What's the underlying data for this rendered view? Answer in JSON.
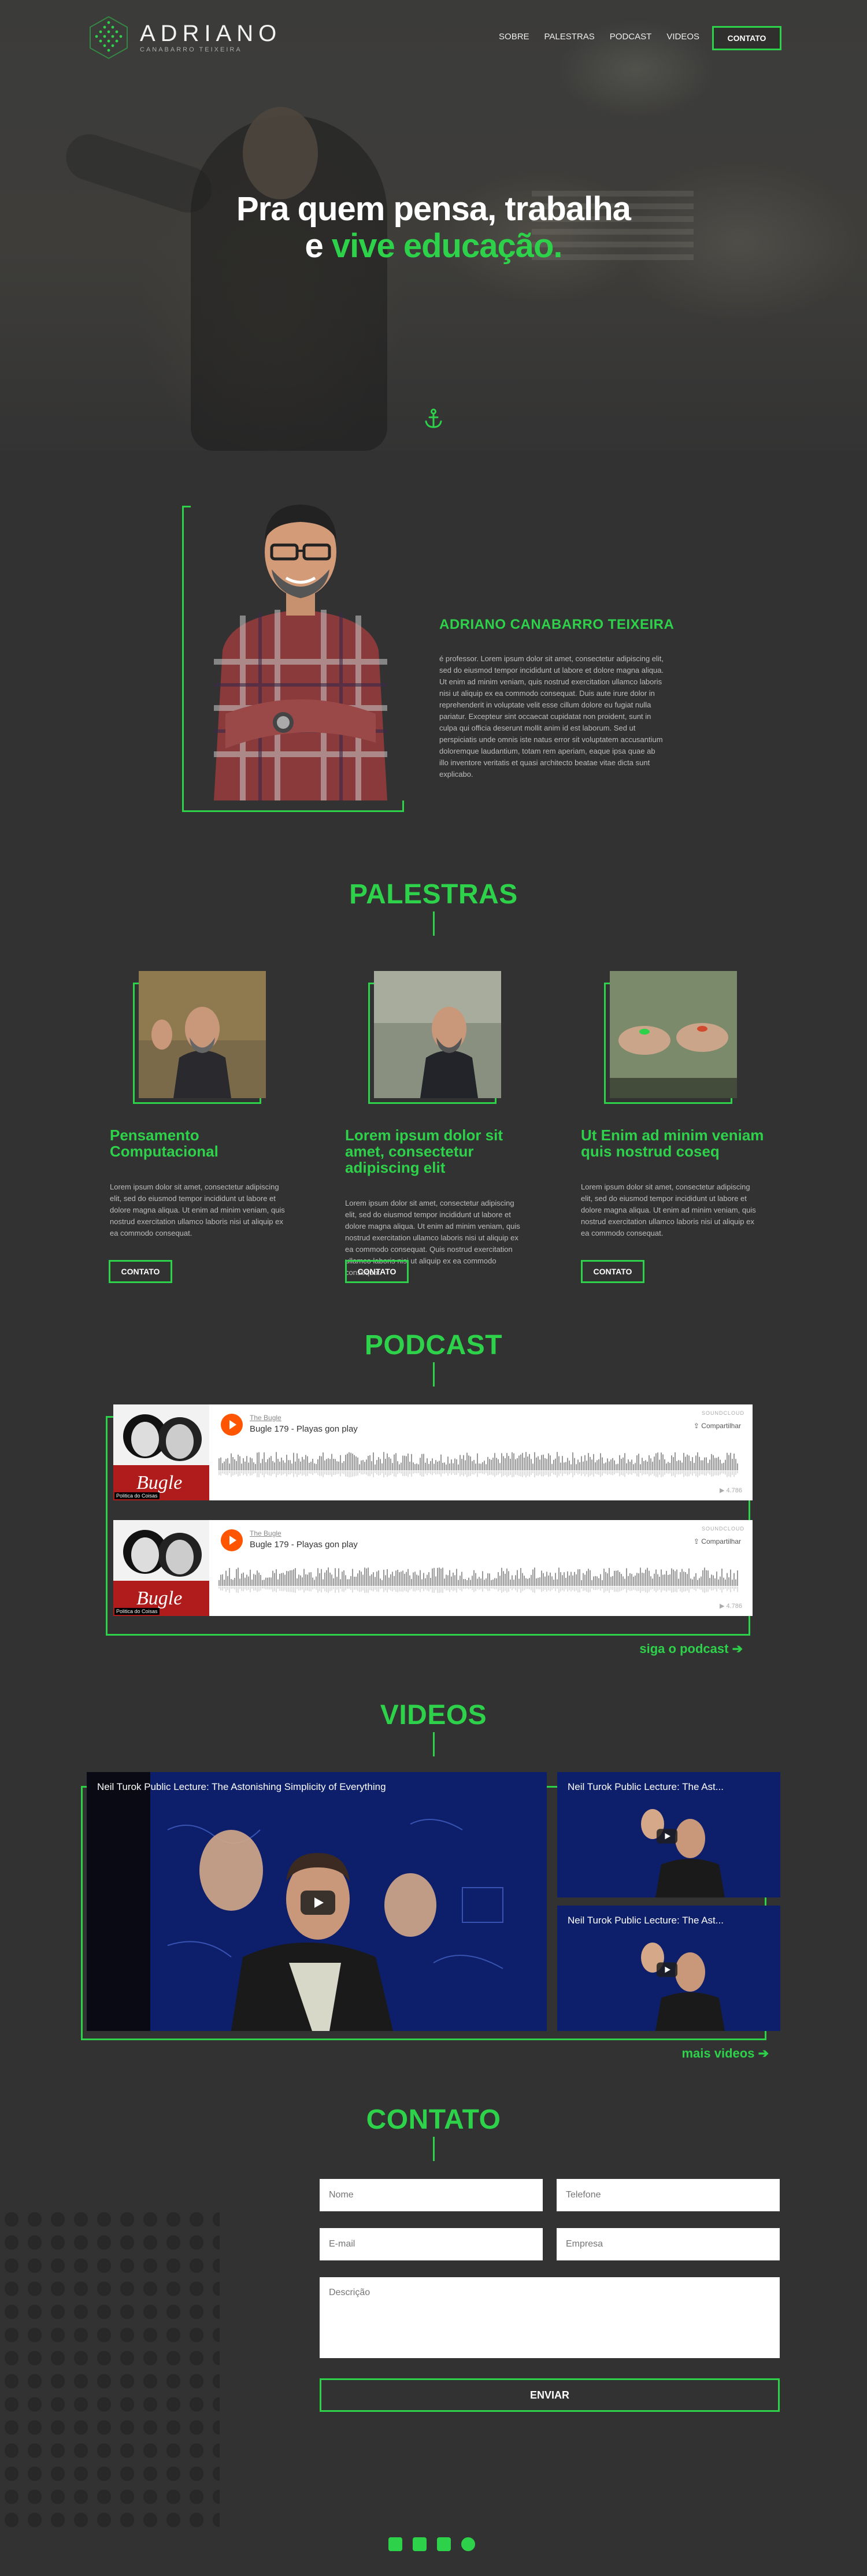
{
  "brand": {
    "name": "ADRIANO",
    "subtitle": "CANABARRO TEIXEIRA"
  },
  "nav": {
    "items": [
      "SOBRE",
      "PALESTRAS",
      "PODCAST",
      "VIDEOS"
    ],
    "cta": "CONTATO"
  },
  "hero": {
    "line1": "Pra quem pensa, trabalha",
    "line2_prefix": "e ",
    "line2_highlight": "vive educação."
  },
  "about": {
    "name": "ADRIANO CANABARRO TEIXEIRA",
    "text": "é professor. Lorem ipsum dolor sit amet, consectetur adipiscing elit, sed do eiusmod tempor incididunt ut labore et dolore magna aliqua. Ut enim ad minim veniam, quis nostrud exercitation ullamco laboris nisi ut aliquip ex ea commodo consequat. Duis aute irure dolor in reprehenderit in voluptate velit esse cillum dolore eu fugiat nulla pariatur. Excepteur sint occaecat cupidatat non proident, sunt in culpa qui officia deserunt mollit anim id est laborum. Sed ut perspiciatis unde omnis iste natus error sit voluptatem accusantium doloremque laudantium, totam rem aperiam, eaque ipsa quae ab illo inventore veritatis et quasi architecto beatae vitae dicta sunt explicabo."
  },
  "palestras": {
    "title": "PALESTRAS",
    "cards": [
      {
        "title": "Pensamento Computacional",
        "text": "Lorem ipsum dolor sit amet, consectetur adipiscing elit, sed do eiusmod tempor incididunt ut labore et dolore magna aliqua. Ut enim ad minim veniam, quis nostrud exercitation ullamco laboris nisi ut aliquip ex ea commodo consequat.",
        "button": "CONTATO"
      },
      {
        "title": "Lorem ipsum dolor sit amet, consectetur adipiscing elit",
        "text": "Lorem ipsum dolor sit amet, consectetur adipiscing elit, sed do eiusmod tempor incididunt ut labore et dolore magna aliqua. Ut enim ad minim veniam, quis nostrud exercitation ullamco laboris nisi ut aliquip ex ea commodo consequat. Quis nostrud exercitation ullamco laboris nisi ut aliquip ex ea commodo consequat.",
        "button": "CONTATO"
      },
      {
        "title": "Ut Enim ad minim veniam quis nostrud coseq",
        "text": "Lorem ipsum dolor sit amet, consectetur adipiscing elit, sed do eiusmod tempor incididunt ut labore et dolore magna aliqua. Ut enim ad minim veniam, quis nostrud exercitation ullamco laboris nisi ut aliquip ex ea commodo consequat.",
        "button": "CONTATO"
      }
    ]
  },
  "podcast": {
    "title": "PODCAST",
    "players": [
      {
        "show": "The Bugle",
        "track": "Bugle 179 - Playas gon play",
        "share": "Compartilhar",
        "sc": "SOUNDCLOUD",
        "time": "1:04",
        "plays": "4.786",
        "art_caption": "Politica do Coisas"
      },
      {
        "show": "The Bugle",
        "track": "Bugle 179 - Playas gon play",
        "share": "Compartilhar",
        "sc": "SOUNDCLOUD",
        "time": "1:04",
        "plays": "4.786",
        "art_caption": "Politica do Coisas"
      }
    ],
    "link": "siga o podcast"
  },
  "videos": {
    "title": "VIDEOS",
    "main": "Neil Turok Public Lecture: The Astonishing Simplicity of Everything",
    "side": [
      "Neil Turok Public Lecture: The Ast...",
      "Neil Turok Public Lecture: The Ast..."
    ],
    "link": "mais videos"
  },
  "contato": {
    "title": "CONTATO",
    "fields": {
      "nome": "Nome",
      "telefone": "Telefone",
      "email": "E-mail",
      "empresa": "Empresa",
      "descricao": "Descrição"
    },
    "send": "ENVIAR"
  },
  "social": [
    "twitter-icon",
    "facebook-icon",
    "youtube-icon",
    "soundcloud-icon"
  ],
  "colors": {
    "accent": "#2ed24a",
    "background": "#323232"
  }
}
